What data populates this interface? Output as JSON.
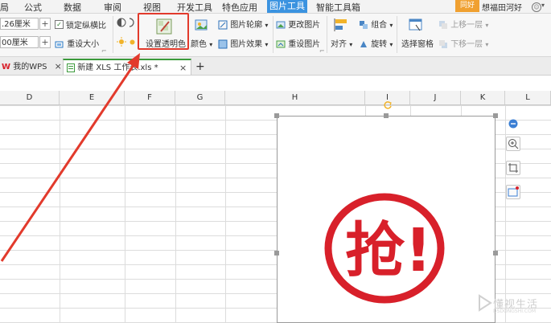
{
  "menubar": {
    "items": [
      "局",
      "公式",
      "数据",
      "审阅",
      "视图",
      "开发工具",
      "特色应用",
      "图片工具",
      "智能工具箱"
    ],
    "active": "图片工具",
    "badge": "同好",
    "username": "想福田河好",
    "user_icon": "☺",
    "caret": "▾"
  },
  "ribbon": {
    "height_value": ".26厘米",
    "width_value": "00厘米",
    "lock_ratio_label": "锁定纵横比",
    "reset_size_label": "重设大小",
    "set_transparent_label": "设置透明色",
    "color_label": "颜色",
    "picture_outline_label": "图片轮廓",
    "picture_effects_label": "图片效果",
    "change_picture_label": "更改图片",
    "reset_picture_label": "重设图片",
    "align_label": "对齐",
    "group_label": "组合",
    "rotate_label": "旋转",
    "selection_pane_label": "选择窗格",
    "bring_forward_label": "上移一层",
    "send_backward_label": "下移一层",
    "plus": "+",
    "caret": "▾",
    "check": "✓",
    "launcher": "⌐"
  },
  "tabs": [
    {
      "label": "我的WPS",
      "close": "×",
      "icon": "W"
    },
    {
      "label": "新建 XLS 工作表.xls *",
      "close": "×"
    }
  ],
  "new_tab": "+",
  "columns": [
    "D",
    "E",
    "F",
    "G",
    "H",
    "I",
    "J",
    "K",
    "L"
  ],
  "stamp_text": "抢!",
  "watermark": {
    "text": "懂视生活",
    "sub": "DSDONGSHI.COM"
  },
  "colors": {
    "accent": "#3b93e0",
    "highlight_red": "#e23a2c",
    "stamp_red": "#d8202a",
    "tab_green": "#3b9a3b"
  }
}
